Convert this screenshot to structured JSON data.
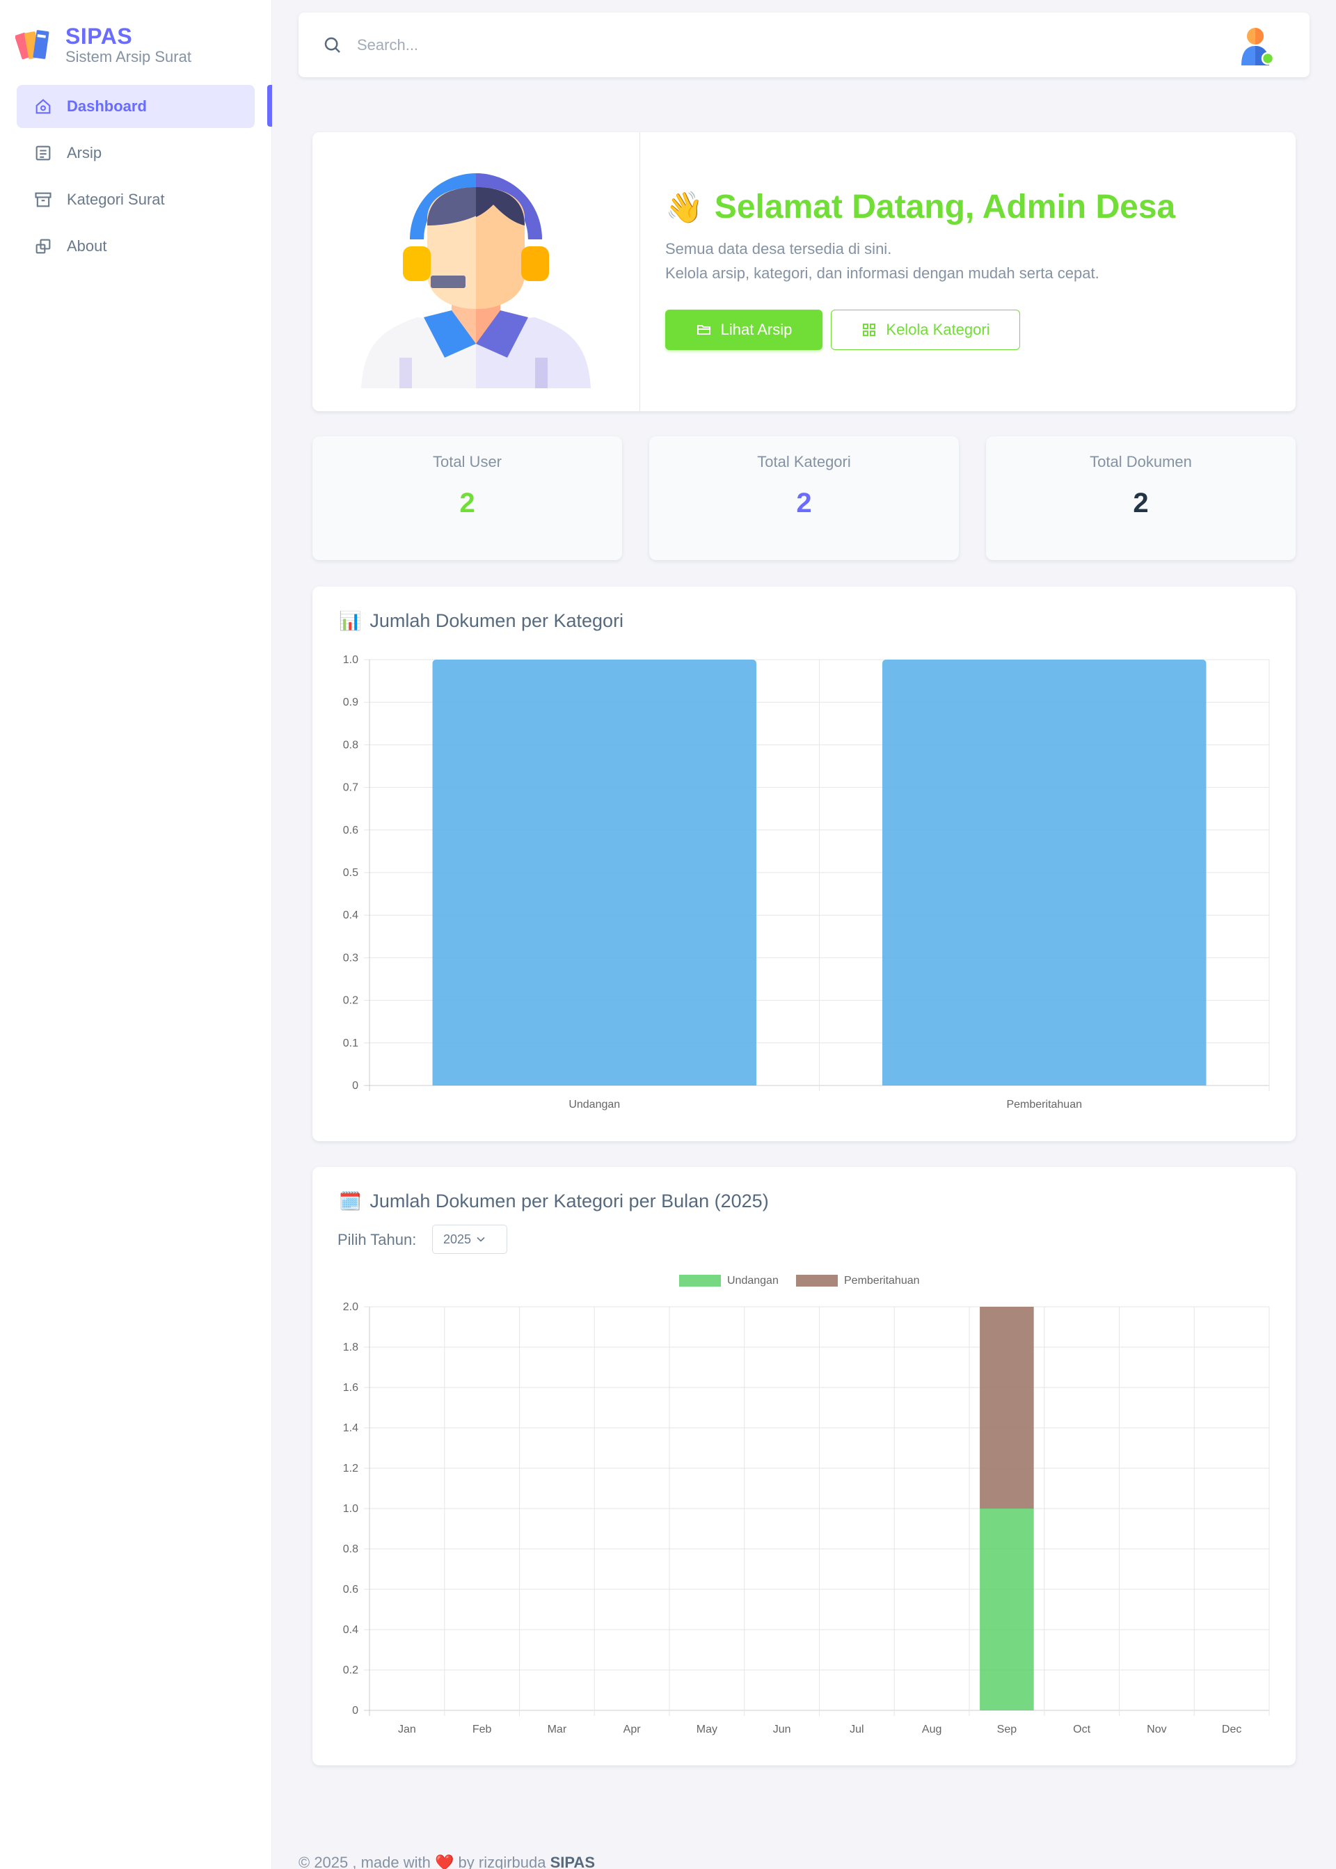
{
  "brand": {
    "title": "SIPAS",
    "subtitle": "Sistem Arsip Surat"
  },
  "sidebar": {
    "items": [
      {
        "label": "Dashboard",
        "icon": "home-icon",
        "active": true
      },
      {
        "label": "Arsip",
        "icon": "document-icon",
        "active": false
      },
      {
        "label": "Kategori Surat",
        "icon": "archive-box-icon",
        "active": false
      },
      {
        "label": "About",
        "icon": "copy-icon",
        "active": false
      }
    ]
  },
  "navbar": {
    "search_placeholder": "Search..."
  },
  "welcome": {
    "emoji": "👋",
    "title": "Selamat Datang, Admin Desa",
    "line1": "Semua data desa tersedia di sini.",
    "line2": "Kelola arsip, kategori, dan informasi dengan mudah serta cepat.",
    "btn_primary": "Lihat Arsip",
    "btn_outline": "Kelola Kategori"
  },
  "stats": [
    {
      "label": "Total User",
      "value": "2",
      "color": "#71dd37"
    },
    {
      "label": "Total Kategori",
      "value": "2",
      "color": "#696cff"
    },
    {
      "label": "Total Dokumen",
      "value": "2",
      "color": "#233446"
    }
  ],
  "chart1": {
    "emoji": "📊",
    "title": "Jumlah Dokumen per Kategori"
  },
  "chart2": {
    "emoji": "🗓️",
    "title": "Jumlah Dokumen per Kategori per Bulan (2025)",
    "year_label": "Pilih Tahun:",
    "year_value": "2025"
  },
  "footer": {
    "prefix": "© 2025 , made with",
    "heart": "❤️",
    "by": "by rizqirbuda",
    "brand": "SIPAS"
  },
  "chart_data": [
    {
      "type": "bar",
      "title": "Jumlah Dokumen per Kategori",
      "categories": [
        "Undangan",
        "Pemberitahuan"
      ],
      "values": [
        1,
        1
      ],
      "ylim": [
        0,
        1
      ],
      "yticks": [
        "0",
        "0.1",
        "0.2",
        "0.3",
        "0.4",
        "0.5",
        "0.6",
        "0.7",
        "0.8",
        "0.9",
        "1.0"
      ],
      "color": "#5eb2ea",
      "grid": true
    },
    {
      "type": "bar",
      "stacked": true,
      "title": "Jumlah Dokumen per Kategori per Bulan (2025)",
      "categories": [
        "Jan",
        "Feb",
        "Mar",
        "Apr",
        "May",
        "Jun",
        "Jul",
        "Aug",
        "Sep",
        "Oct",
        "Nov",
        "Dec"
      ],
      "series": [
        {
          "name": "Undangan",
          "color": "#5fd16c",
          "values": [
            0,
            0,
            0,
            0,
            0,
            0,
            0,
            0,
            1,
            0,
            0,
            0
          ]
        },
        {
          "name": "Pemberitahuan",
          "color": "#9b7264",
          "values": [
            0,
            0,
            0,
            0,
            0,
            0,
            0,
            0,
            1,
            0,
            0,
            0
          ]
        }
      ],
      "ylim": [
        0,
        2
      ],
      "yticks": [
        "0",
        "0.2",
        "0.4",
        "0.6",
        "0.8",
        "1.0",
        "1.2",
        "1.4",
        "1.6",
        "1.8",
        "2.0"
      ],
      "legend": "top-center",
      "grid": true
    }
  ]
}
